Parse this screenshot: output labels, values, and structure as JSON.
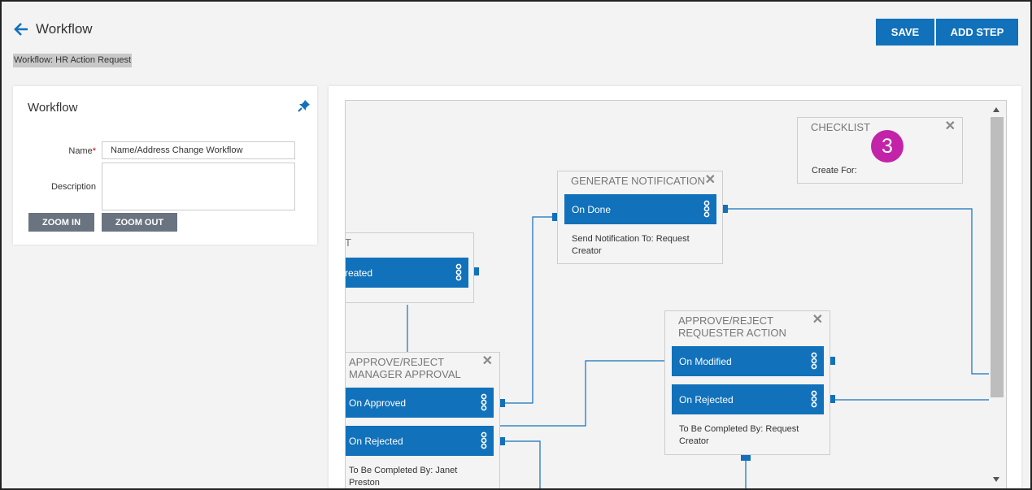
{
  "header": {
    "title": "Workflow",
    "breadcrumb": "Workflow: HR Action Request",
    "save_label": "SAVE",
    "add_step_label": "ADD STEP"
  },
  "workflow_panel": {
    "title": "Workflow",
    "name_label": "Name",
    "name_value": "Name/Address Change Workflow",
    "description_label": "Description",
    "description_value": "",
    "zoom_in_label": "ZOOM IN",
    "zoom_out_label": "ZOOM OUT"
  },
  "canvas": {
    "badge": "3",
    "steps": {
      "checklist": {
        "title": "CHECKLIST",
        "note": "Create For:"
      },
      "generate_notification": {
        "title": "GENERATE NOTIFICATION",
        "outcomes": [
          "On Done"
        ],
        "note": "Send Notification To: Request\nCreator"
      },
      "partial_start": {
        "title": "T",
        "outcomes": [
          "reated"
        ]
      },
      "manager_approval": {
        "title": "APPROVE/REJECT\nMANAGER APPROVAL",
        "outcomes": [
          "On Approved",
          "On Rejected"
        ],
        "note": "To Be Completed By: Janet\nPreston"
      },
      "requester_action": {
        "title": "APPROVE/REJECT\nREQUESTER ACTION",
        "outcomes": [
          "On Modified",
          "On Rejected"
        ],
        "note": "To Be Completed By: Request\nCreator"
      }
    }
  },
  "colors": {
    "accent": "#1171ba",
    "badge": "#c323a8",
    "grey_button": "#6a7480"
  },
  "icons": {
    "back": "arrow-left-icon",
    "pin": "pin-icon",
    "close": "close-icon",
    "outcome_menu": "vertical-dots-icon"
  }
}
